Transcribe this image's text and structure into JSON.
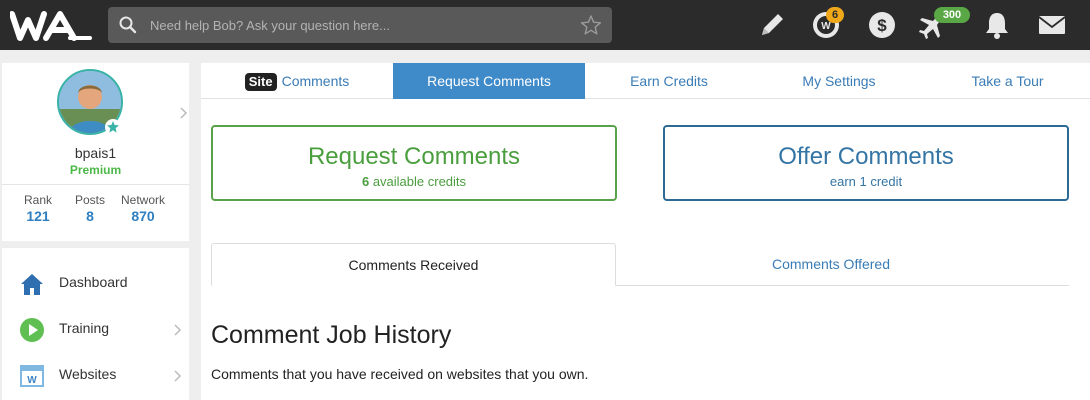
{
  "search": {
    "placeholder": "Need help Bob? Ask your question here..."
  },
  "topbar": {
    "logo_alt": "WA",
    "notifications": {
      "wa_badge": "6",
      "flight_badge": "300"
    }
  },
  "profile": {
    "username": "bpais1",
    "level": "Premium",
    "stats": [
      {
        "label": "Rank",
        "value": "121"
      },
      {
        "label": "Posts",
        "value": "8"
      },
      {
        "label": "Network",
        "value": "870"
      }
    ]
  },
  "nav": {
    "items": [
      {
        "label": "Dashboard"
      },
      {
        "label": "Training"
      },
      {
        "label": "Websites"
      }
    ]
  },
  "main": {
    "tabs": {
      "site_pill": "Site",
      "comments": "Comments",
      "request": "Request Comments",
      "earn": "Earn Credits",
      "settings": "My Settings",
      "tour": "Take a Tour"
    },
    "request_card": {
      "title": "Request Comments",
      "credits": "6",
      "credits_suffix": "available credits"
    },
    "offer_card": {
      "title": "Offer Comments",
      "subtitle": "earn 1 credit"
    },
    "subtabs": {
      "received": "Comments Received",
      "offered": "Comments Offered"
    },
    "history": {
      "title": "Comment Job History",
      "description": "Comments that you have received on websites that you own."
    }
  },
  "colors": {
    "topbar": "#2b2b2b",
    "accent_blue": "#3f8ac9",
    "green": "#4a9e3e",
    "dark_blue": "#2d6a93",
    "badge_orange": "#f0a81b",
    "badge_green": "#59a845"
  }
}
